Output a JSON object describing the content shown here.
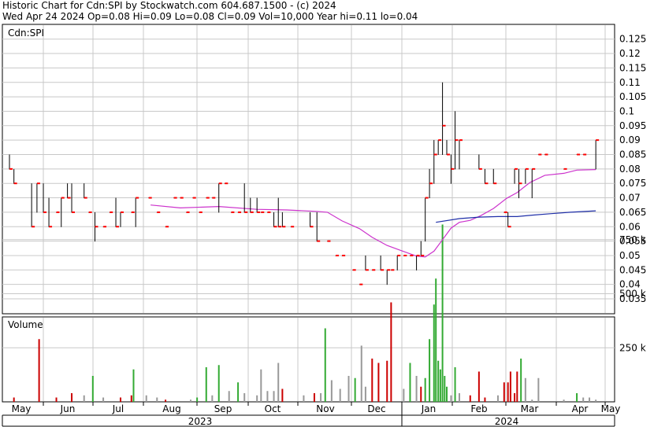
{
  "header": {
    "line1": "Historic Chart for Cdn:SPI by Stockwatch.com 604.687.1500 - (c) 2024",
    "line2": "Wed Apr 24 2024  Op=0.08  Hi=0.09  Lo=0.08  Cl=0.09  Vol=10,000  Year hi=0.11  lo=0.04"
  },
  "colors": {
    "up": "#000000",
    "down": "#ff0000",
    "ma_short": "#cc33cc",
    "ma_long": "#1f2fa8",
    "vol_up": "#33aa33",
    "vol_down": "#cc0000",
    "vol_flat": "#999999",
    "grid": "#c8c8c8"
  },
  "chart_data": [
    {
      "type": "bar",
      "subtype": "ohlc",
      "legend": "Cdn:SPI",
      "ylim": [
        0.03,
        0.13
      ],
      "yticks": [
        0.035,
        0.04,
        0.045,
        0.05,
        0.055,
        0.06,
        0.065,
        0.07,
        0.075,
        0.08,
        0.085,
        0.09,
        0.095,
        0.1,
        0.105,
        0.11,
        0.115,
        0.12,
        0.125
      ],
      "ytick_labels": [
        "0.035",
        "0.04",
        "0.045",
        "0.05",
        "0.055",
        "0.06",
        "0.065",
        "0.07",
        "0.075",
        "0.08",
        "0.085",
        "0.09",
        "0.095",
        "0.1",
        "0.105",
        "0.11",
        "0.115",
        "0.12",
        "0.125"
      ],
      "months": [
        "May",
        "Jun",
        "Jul",
        "Aug",
        "Sep",
        "Oct",
        "Nov",
        "Dec",
        "Jan",
        "Feb",
        "Mar",
        "Apr",
        "May"
      ],
      "years": [
        "2023",
        "2024"
      ],
      "grid": true,
      "bars": [
        {
          "t": 0.0,
          "h": 0.085,
          "l": 0.08,
          "c": 0.08
        },
        {
          "t": 2.1,
          "h": 0.08,
          "l": 0.075,
          "c": 0.075
        },
        {
          "t": 10.4,
          "h": 0.075,
          "l": 0.06,
          "c": 0.06
        },
        {
          "t": 12.9,
          "h": 0.075,
          "l": 0.065,
          "c": 0.075
        },
        {
          "t": 15.9,
          "h": 0.075,
          "l": 0.065,
          "c": 0.065
        },
        {
          "t": 18.5,
          "h": 0.07,
          "l": 0.06,
          "c": 0.06
        },
        {
          "t": 22.0,
          "h": 0.065,
          "l": 0.065,
          "c": 0.065
        },
        {
          "t": 24.3,
          "h": 0.07,
          "l": 0.06,
          "c": 0.07
        },
        {
          "t": 27.2,
          "h": 0.075,
          "l": 0.07,
          "c": 0.07
        },
        {
          "t": 29.2,
          "h": 0.075,
          "l": 0.065,
          "c": 0.065
        },
        {
          "t": 35.0,
          "h": 0.075,
          "l": 0.07,
          "c": 0.07
        },
        {
          "t": 37.2,
          "h": 0.065,
          "l": 0.065,
          "c": 0.065
        },
        {
          "t": 40.1,
          "h": 0.065,
          "l": 0.055,
          "c": 0.06
        },
        {
          "t": 44.0,
          "h": 0.06,
          "l": 0.06,
          "c": 0.06
        },
        {
          "t": 47.0,
          "h": 0.065,
          "l": 0.065,
          "c": 0.065
        },
        {
          "t": 49.9,
          "h": 0.07,
          "l": 0.06,
          "c": 0.06
        },
        {
          "t": 52.1,
          "h": 0.065,
          "l": 0.06,
          "c": 0.065
        },
        {
          "t": 57.2,
          "h": 0.065,
          "l": 0.065,
          "c": 0.065
        },
        {
          "t": 59.2,
          "h": 0.07,
          "l": 0.06,
          "c": 0.07
        },
        {
          "t": 65.3,
          "h": 0.07,
          "l": 0.07,
          "c": 0.07
        },
        {
          "t": 69.2,
          "h": 0.065,
          "l": 0.065,
          "c": 0.065
        },
        {
          "t": 73.2,
          "h": 0.06,
          "l": 0.06,
          "c": 0.06
        },
        {
          "t": 77.1,
          "h": 0.07,
          "l": 0.07,
          "c": 0.07
        },
        {
          "t": 80.1,
          "h": 0.07,
          "l": 0.07,
          "c": 0.07
        },
        {
          "t": 83.0,
          "h": 0.065,
          "l": 0.065,
          "c": 0.065
        },
        {
          "t": 86.0,
          "h": 0.07,
          "l": 0.07,
          "c": 0.07
        },
        {
          "t": 89.0,
          "h": 0.065,
          "l": 0.065,
          "c": 0.065
        },
        {
          "t": 92.3,
          "h": 0.07,
          "l": 0.07,
          "c": 0.07
        },
        {
          "t": 95.1,
          "h": 0.07,
          "l": 0.07,
          "c": 0.07
        },
        {
          "t": 98.2,
          "h": 0.075,
          "l": 0.065,
          "c": 0.075
        },
        {
          "t": 101.0,
          "h": 0.075,
          "l": 0.075,
          "c": 0.075
        },
        {
          "t": 104.0,
          "h": 0.065,
          "l": 0.065,
          "c": 0.065
        },
        {
          "t": 107.2,
          "h": 0.065,
          "l": 0.065,
          "c": 0.065
        },
        {
          "t": 110.2,
          "h": 0.075,
          "l": 0.065,
          "c": 0.065
        },
        {
          "t": 113.0,
          "h": 0.07,
          "l": 0.065,
          "c": 0.065
        },
        {
          "t": 116.1,
          "h": 0.07,
          "l": 0.065,
          "c": 0.065
        },
        {
          "t": 118.0,
          "h": 0.065,
          "l": 0.065,
          "c": 0.065
        },
        {
          "t": 121.0,
          "h": 0.065,
          "l": 0.065,
          "c": 0.065
        },
        {
          "t": 124.0,
          "h": 0.065,
          "l": 0.06,
          "c": 0.06
        },
        {
          "t": 126.1,
          "h": 0.07,
          "l": 0.06,
          "c": 0.06
        },
        {
          "t": 128.0,
          "h": 0.065,
          "l": 0.06,
          "c": 0.06
        },
        {
          "t": 132.0,
          "h": 0.06,
          "l": 0.06,
          "c": 0.06
        },
        {
          "t": 141.0,
          "h": 0.065,
          "l": 0.06,
          "c": 0.06
        },
        {
          "t": 144.2,
          "h": 0.065,
          "l": 0.055,
          "c": 0.055
        },
        {
          "t": 149.1,
          "h": 0.055,
          "l": 0.055,
          "c": 0.055
        },
        {
          "t": 153.0,
          "h": 0.05,
          "l": 0.05,
          "c": 0.05
        },
        {
          "t": 156.0,
          "h": 0.05,
          "l": 0.05,
          "c": 0.05
        },
        {
          "t": 161.0,
          "h": 0.045,
          "l": 0.045,
          "c": 0.045
        },
        {
          "t": 164.2,
          "h": 0.04,
          "l": 0.04,
          "c": 0.04
        },
        {
          "t": 167.0,
          "h": 0.05,
          "l": 0.045,
          "c": 0.045
        },
        {
          "t": 170.1,
          "h": 0.045,
          "l": 0.045,
          "c": 0.045
        },
        {
          "t": 174.1,
          "h": 0.05,
          "l": 0.045,
          "c": 0.045
        },
        {
          "t": 177.1,
          "h": 0.045,
          "l": 0.04,
          "c": 0.045
        },
        {
          "t": 179.0,
          "h": 0.045,
          "l": 0.045,
          "c": 0.045
        },
        {
          "t": 181.9,
          "h": 0.05,
          "l": 0.045,
          "c": 0.05
        },
        {
          "t": 184.9,
          "h": 0.05,
          "l": 0.05,
          "c": 0.05
        },
        {
          "t": 187.9,
          "h": 0.05,
          "l": 0.05,
          "c": 0.05
        },
        {
          "t": 190.9,
          "h": 0.05,
          "l": 0.045,
          "c": 0.05
        },
        {
          "t": 193.0,
          "h": 0.055,
          "l": 0.05,
          "c": 0.05
        },
        {
          "t": 195.0,
          "h": 0.07,
          "l": 0.055,
          "c": 0.07
        },
        {
          "t": 197.0,
          "h": 0.08,
          "l": 0.07,
          "c": 0.075
        },
        {
          "t": 199.1,
          "h": 0.09,
          "l": 0.075,
          "c": 0.085
        },
        {
          "t": 201.1,
          "h": 0.09,
          "l": 0.085,
          "c": 0.09
        },
        {
          "t": 203.1,
          "h": 0.11,
          "l": 0.085,
          "c": 0.095
        },
        {
          "t": 205.1,
          "h": 0.09,
          "l": 0.085,
          "c": 0.085
        },
        {
          "t": 207.1,
          "h": 0.085,
          "l": 0.075,
          "c": 0.08
        },
        {
          "t": 209.0,
          "h": 0.1,
          "l": 0.08,
          "c": 0.09
        },
        {
          "t": 211.0,
          "h": 0.09,
          "l": 0.08,
          "c": 0.09
        },
        {
          "t": 220.2,
          "h": 0.085,
          "l": 0.08,
          "c": 0.08
        },
        {
          "t": 223.0,
          "h": 0.08,
          "l": 0.075,
          "c": 0.075
        },
        {
          "t": 227.0,
          "h": 0.08,
          "l": 0.075,
          "c": 0.075
        },
        {
          "t": 232.0,
          "h": 0.065,
          "l": 0.065,
          "c": 0.065
        },
        {
          "t": 233.8,
          "h": 0.065,
          "l": 0.06,
          "c": 0.06
        },
        {
          "t": 236.9,
          "h": 0.08,
          "l": 0.075,
          "c": 0.08
        },
        {
          "t": 238.9,
          "h": 0.08,
          "l": 0.07,
          "c": 0.075
        },
        {
          "t": 242.0,
          "h": 0.08,
          "l": 0.075,
          "c": 0.08
        },
        {
          "t": 245.1,
          "h": 0.08,
          "l": 0.07,
          "c": 0.08
        },
        {
          "t": 248.1,
          "h": 0.085,
          "l": 0.085,
          "c": 0.085
        },
        {
          "t": 251.1,
          "h": 0.085,
          "l": 0.085,
          "c": 0.085
        },
        {
          "t": 260.0,
          "h": 0.08,
          "l": 0.08,
          "c": 0.08
        },
        {
          "t": 266.1,
          "h": 0.085,
          "l": 0.085,
          "c": 0.085
        },
        {
          "t": 269.1,
          "h": 0.085,
          "l": 0.085,
          "c": 0.085
        },
        {
          "t": 275.0,
          "h": 0.09,
          "l": 0.08,
          "c": 0.09
        }
      ],
      "ma_short": [
        {
          "t": 66.2,
          "v": 0.0675
        },
        {
          "t": 80.1,
          "v": 0.0665
        },
        {
          "t": 98.2,
          "v": 0.067
        },
        {
          "t": 115.9,
          "v": 0.066
        },
        {
          "t": 130.1,
          "v": 0.0658
        },
        {
          "t": 144.0,
          "v": 0.0653
        },
        {
          "t": 149.1,
          "v": 0.065
        },
        {
          "t": 156.0,
          "v": 0.062
        },
        {
          "t": 164.2,
          "v": 0.0593
        },
        {
          "t": 170.1,
          "v": 0.0563
        },
        {
          "t": 177.1,
          "v": 0.0535
        },
        {
          "t": 184.9,
          "v": 0.0514
        },
        {
          "t": 190.9,
          "v": 0.0498
        },
        {
          "t": 195.0,
          "v": 0.0495
        },
        {
          "t": 199.1,
          "v": 0.0515
        },
        {
          "t": 203.1,
          "v": 0.0555
        },
        {
          "t": 207.1,
          "v": 0.0595
        },
        {
          "t": 211.0,
          "v": 0.0615
        },
        {
          "t": 216.1,
          "v": 0.0622
        },
        {
          "t": 221.0,
          "v": 0.0638
        },
        {
          "t": 227.0,
          "v": 0.0663
        },
        {
          "t": 233.1,
          "v": 0.0698
        },
        {
          "t": 238.1,
          "v": 0.0718
        },
        {
          "t": 244.1,
          "v": 0.0753
        },
        {
          "t": 251.1,
          "v": 0.0778
        },
        {
          "t": 260.0,
          "v": 0.0785
        },
        {
          "t": 266.1,
          "v": 0.0796
        },
        {
          "t": 275.0,
          "v": 0.0798
        }
      ],
      "ma_long": [
        {
          "t": 200.0,
          "v": 0.0615
        },
        {
          "t": 211.0,
          "v": 0.0628
        },
        {
          "t": 220.2,
          "v": 0.0633
        },
        {
          "t": 229.1,
          "v": 0.0635
        },
        {
          "t": 238.1,
          "v": 0.0635
        },
        {
          "t": 245.1,
          "v": 0.064
        },
        {
          "t": 254.1,
          "v": 0.0645
        },
        {
          "t": 263.1,
          "v": 0.065
        },
        {
          "t": 275.0,
          "v": 0.0655
        }
      ]
    },
    {
      "type": "bar",
      "subtype": "volume",
      "label": "Volume",
      "ylim": [
        0,
        950000
      ],
      "yticks": [
        250000,
        500000,
        750000
      ],
      "ytick_labels": [
        "250 k",
        "500 k",
        "750 k"
      ],
      "bars": [
        {
          "t": 2.1,
          "v": 20000,
          "d": "down"
        },
        {
          "t": 13.9,
          "v": 290000,
          "d": "down"
        },
        {
          "t": 22.0,
          "v": 20000,
          "d": "down"
        },
        {
          "t": 29.2,
          "v": 40000,
          "d": "down"
        },
        {
          "t": 35.0,
          "v": 30000,
          "d": "flat"
        },
        {
          "t": 39.1,
          "v": 120000,
          "d": "up"
        },
        {
          "t": 44.0,
          "v": 20000,
          "d": "flat"
        },
        {
          "t": 52.1,
          "v": 20000,
          "d": "down"
        },
        {
          "t": 57.2,
          "v": 30000,
          "d": "down"
        },
        {
          "t": 58.2,
          "v": 150000,
          "d": "up"
        },
        {
          "t": 64.2,
          "v": 30000,
          "d": "flat"
        },
        {
          "t": 69.2,
          "v": 20000,
          "d": "flat"
        },
        {
          "t": 73.2,
          "v": 10000,
          "d": "down"
        },
        {
          "t": 85.0,
          "v": 10000,
          "d": "flat"
        },
        {
          "t": 88.0,
          "v": 20000,
          "d": "up"
        },
        {
          "t": 92.3,
          "v": 160000,
          "d": "up"
        },
        {
          "t": 95.1,
          "v": 30000,
          "d": "flat"
        },
        {
          "t": 98.2,
          "v": 170000,
          "d": "up"
        },
        {
          "t": 103.0,
          "v": 50000,
          "d": "flat"
        },
        {
          "t": 107.2,
          "v": 90000,
          "d": "up"
        },
        {
          "t": 110.2,
          "v": 40000,
          "d": "flat"
        },
        {
          "t": 116.1,
          "v": 30000,
          "d": "flat"
        },
        {
          "t": 118.0,
          "v": 150000,
          "d": "flat"
        },
        {
          "t": 121.0,
          "v": 50000,
          "d": "flat"
        },
        {
          "t": 124.0,
          "v": 50000,
          "d": "flat"
        },
        {
          "t": 126.1,
          "v": 180000,
          "d": "flat"
        },
        {
          "t": 128.0,
          "v": 60000,
          "d": "down"
        },
        {
          "t": 138.0,
          "v": 30000,
          "d": "flat"
        },
        {
          "t": 143.0,
          "v": 40000,
          "d": "down"
        },
        {
          "t": 146.0,
          "v": 40000,
          "d": "flat"
        },
        {
          "t": 148.1,
          "v": 340000,
          "d": "up"
        },
        {
          "t": 151.1,
          "v": 100000,
          "d": "flat"
        },
        {
          "t": 155.1,
          "v": 60000,
          "d": "flat"
        },
        {
          "t": 159.1,
          "v": 120000,
          "d": "flat"
        },
        {
          "t": 162.1,
          "v": 110000,
          "d": "up"
        },
        {
          "t": 165.1,
          "v": 260000,
          "d": "flat"
        },
        {
          "t": 167.0,
          "v": 70000,
          "d": "flat"
        },
        {
          "t": 170.1,
          "v": 200000,
          "d": "down"
        },
        {
          "t": 173.1,
          "v": 180000,
          "d": "down"
        },
        {
          "t": 177.1,
          "v": 190000,
          "d": "down"
        },
        {
          "t": 179.0,
          "v": 460000,
          "d": "down"
        },
        {
          "t": 184.9,
          "v": 60000,
          "d": "flat"
        },
        {
          "t": 187.9,
          "v": 180000,
          "d": "up"
        },
        {
          "t": 190.9,
          "v": 120000,
          "d": "flat"
        },
        {
          "t": 193.0,
          "v": 70000,
          "d": "down"
        },
        {
          "t": 195.0,
          "v": 110000,
          "d": "up"
        },
        {
          "t": 197.0,
          "v": 290000,
          "d": "up"
        },
        {
          "t": 199.1,
          "v": 450000,
          "d": "up"
        },
        {
          "t": 200.0,
          "v": 570000,
          "d": "up"
        },
        {
          "t": 201.1,
          "v": 190000,
          "d": "up"
        },
        {
          "t": 202.1,
          "v": 150000,
          "d": "up"
        },
        {
          "t": 203.1,
          "v": 820000,
          "d": "up"
        },
        {
          "t": 204.1,
          "v": 120000,
          "d": "up"
        },
        {
          "t": 205.1,
          "v": 70000,
          "d": "up"
        },
        {
          "t": 207.1,
          "v": 30000,
          "d": "flat"
        },
        {
          "t": 209.0,
          "v": 160000,
          "d": "up"
        },
        {
          "t": 211.0,
          "v": 40000,
          "d": "flat"
        },
        {
          "t": 216.1,
          "v": 30000,
          "d": "down"
        },
        {
          "t": 220.2,
          "v": 140000,
          "d": "down"
        },
        {
          "t": 223.0,
          "v": 20000,
          "d": "down"
        },
        {
          "t": 229.1,
          "v": 30000,
          "d": "flat"
        },
        {
          "t": 232.0,
          "v": 90000,
          "d": "down"
        },
        {
          "t": 233.8,
          "v": 90000,
          "d": "down"
        },
        {
          "t": 235.0,
          "v": 140000,
          "d": "down"
        },
        {
          "t": 236.9,
          "v": 40000,
          "d": "down"
        },
        {
          "t": 238.1,
          "v": 140000,
          "d": "down"
        },
        {
          "t": 239.9,
          "v": 200000,
          "d": "up"
        },
        {
          "t": 242.0,
          "v": 110000,
          "d": "flat"
        },
        {
          "t": 245.1,
          "v": 10000,
          "d": "flat"
        },
        {
          "t": 248.1,
          "v": 110000,
          "d": "flat"
        },
        {
          "t": 260.0,
          "v": 10000,
          "d": "flat"
        },
        {
          "t": 266.1,
          "v": 40000,
          "d": "up"
        },
        {
          "t": 269.1,
          "v": 20000,
          "d": "flat"
        },
        {
          "t": 272.0,
          "v": 20000,
          "d": "flat"
        },
        {
          "t": 275.0,
          "v": 10000,
          "d": "flat"
        }
      ]
    }
  ]
}
